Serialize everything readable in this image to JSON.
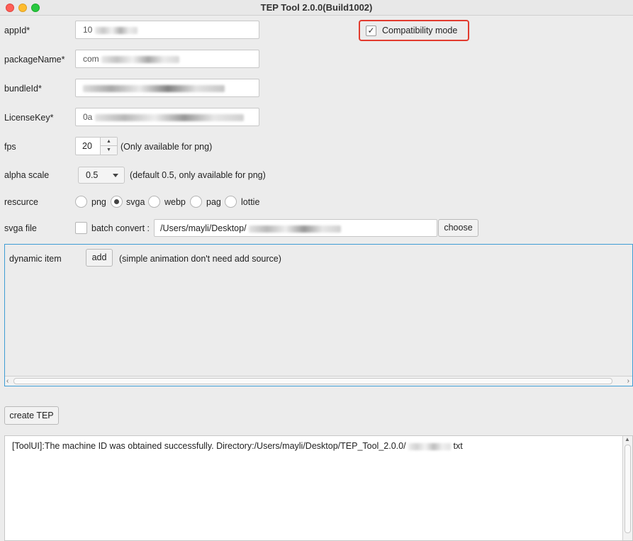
{
  "window": {
    "title": "TEP Tool 2.0.0(Build1002)"
  },
  "form": {
    "appid_label": "appId*",
    "appid_value": "10",
    "packagename_label": "packageName*",
    "packagename_value": "com",
    "bundleid_label": "bundleId*",
    "licensekey_label": "LicenseKey*",
    "licensekey_value": "0a",
    "fps_label": "fps",
    "fps_value": "20",
    "fps_note": "(Only available for png)",
    "alpha_label": "alpha scale",
    "alpha_value": "0.5",
    "alpha_note": "(default 0.5, only available for png)",
    "resource_label": "rescurce",
    "resource_options": [
      "png",
      "svga",
      "webp",
      "pag",
      "lottie"
    ],
    "resource_selected": "svga",
    "svga_label": "svga file",
    "batch_label": "batch convert :",
    "svga_path": "/Users/mayli/Desktop/",
    "choose_label": "choose",
    "compat_label": "Compatibility mode",
    "compat_checked": true
  },
  "dynamic": {
    "label": "dynamic item",
    "add_label": "add",
    "note": "(simple animation don't need add source)"
  },
  "actions": {
    "create_label": "create TEP"
  },
  "log": {
    "line": "[ToolUI]:The machine ID was obtained successfully. Directory:/Users/mayli/Desktop/TEP_Tool_2.0.0/",
    "line_end": "txt"
  },
  "icons": {
    "check": "check-icon",
    "spin_up": "spinner-up-icon",
    "spin_down": "spinner-down-icon",
    "chevron": "chevron-down-icon",
    "scroll_left": "scroll-left-icon",
    "scroll_right": "scroll-right-icon",
    "scroll_up": "scroll-up-icon"
  }
}
